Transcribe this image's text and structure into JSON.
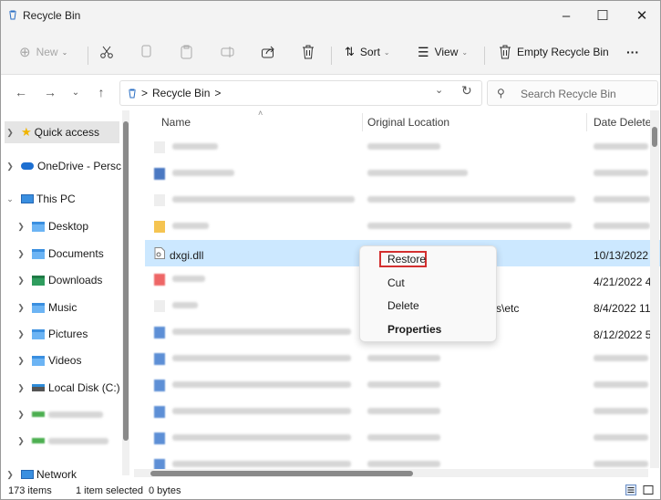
{
  "window": {
    "title": "Recycle Bin",
    "controls": {
      "minimize": "–",
      "maximize": "☐",
      "close": "✕"
    }
  },
  "commandbar": {
    "new_label": "New",
    "sort_label": "Sort",
    "view_label": "View",
    "empty_label": "Empty Recycle Bin",
    "more_label": "···"
  },
  "address": {
    "crumb_root_sep": ">",
    "location": "Recycle Bin",
    "crumb_trail_sep": ">"
  },
  "search": {
    "placeholder": "Search Recycle Bin"
  },
  "navpane": {
    "items": [
      {
        "label": "Quick access"
      },
      {
        "label": "OneDrive - Persc"
      },
      {
        "label": "This PC"
      },
      {
        "label": "Desktop"
      },
      {
        "label": "Documents"
      },
      {
        "label": "Downloads"
      },
      {
        "label": "Music"
      },
      {
        "label": "Pictures"
      },
      {
        "label": "Videos"
      },
      {
        "label": "Local Disk (C:)"
      },
      {
        "label": "Network"
      }
    ]
  },
  "columns": {
    "name": "Name",
    "original_location": "Original Location",
    "date_deleted": "Date Delete"
  },
  "files": {
    "visible": [
      {
        "name": "dxgi.dll",
        "date": "10/13/2022"
      },
      {
        "date": "4/21/2022 4"
      },
      {
        "location_suffix": "s\\etc",
        "date": "8/4/2022 11:"
      },
      {
        "date": "8/12/2022 5"
      }
    ]
  },
  "context_menu": {
    "items": [
      {
        "label": "Restore",
        "highlighted": true
      },
      {
        "label": "Cut"
      },
      {
        "label": "Delete"
      },
      {
        "label": "Properties"
      }
    ]
  },
  "statusbar": {
    "item_count": "173 items",
    "selection": "1 item selected",
    "size": "0 bytes"
  },
  "colors": {
    "selection": "#cce8ff",
    "highlight_box": "#d32f2f",
    "folder": "#6cb4f4"
  }
}
